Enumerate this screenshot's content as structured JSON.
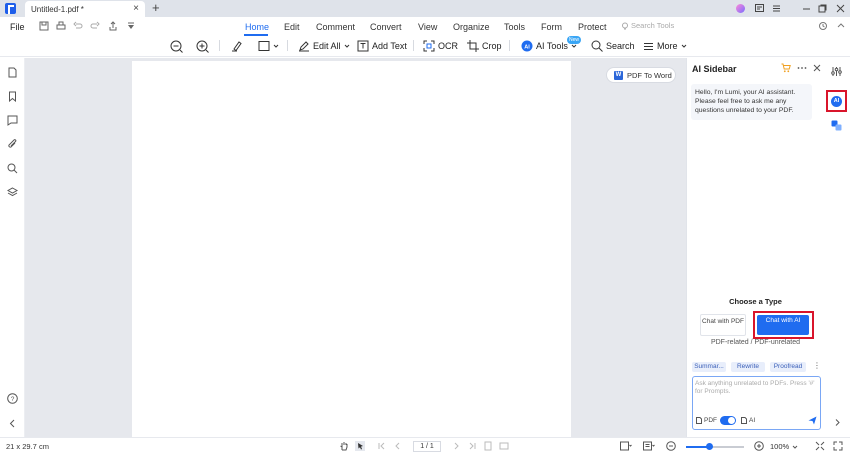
{
  "titlebar": {
    "tab_title": "Untitled-1.pdf *",
    "tab_close": "×",
    "new_tab": "+"
  },
  "menu": {
    "file": "File",
    "tabs": [
      "Home",
      "Edit",
      "Comment",
      "Convert",
      "View",
      "Organize",
      "Tools",
      "Form",
      "Protect"
    ],
    "search_tools": "Search Tools"
  },
  "toolbar": {
    "edit_all": "Edit All",
    "add_text": "Add Text",
    "ocr": "OCR",
    "crop": "Crop",
    "ai_tools": "AI Tools",
    "ai_tools_badge": "New",
    "search": "Search",
    "more": "More"
  },
  "canvas": {
    "pdf_to_word": "PDF To Word",
    "word_icon_letter": "W"
  },
  "ai_sidebar": {
    "title": "AI Sidebar",
    "greeting": "Hello, I'm Lumi, your AI assistant. Please feel free to ask me any questions unrelated to your PDF.",
    "choose_type": "Choose a Type",
    "chat_with_pdf": "Chat with PDF",
    "chat_with_ai": "Chat with AI",
    "type_caption": "PDF-related / PDF-unrelated",
    "chips": [
      "Summar...",
      "Rewrite",
      "Proofread"
    ],
    "input_placeholder": "Ask anything unrelated to PDFs. Press '#' for Prompts.",
    "toggle_pdf": "PDF",
    "toggle_ai": "AI",
    "toggle_on": true
  },
  "right_rail": {
    "ai_icon_label": "AI"
  },
  "status": {
    "page_size": "21 x 29.7 cm",
    "page_indicator": "1 / 1",
    "zoom": "100%",
    "zoom_fraction": 0.4
  },
  "colors": {
    "accent": "#1f6cf0",
    "highlight_box": "#d9152b"
  }
}
